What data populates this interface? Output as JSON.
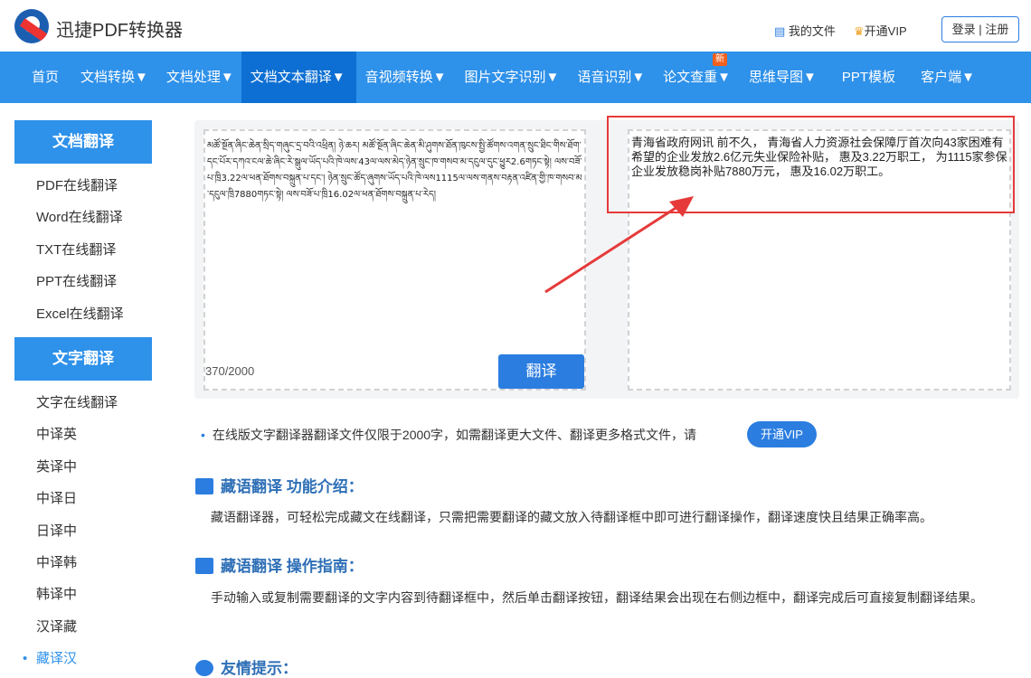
{
  "header": {
    "brand": "迅捷PDF转换器",
    "my_files": "我的文件",
    "open_vip": "开通VIP",
    "login": "登录",
    "sep": "|",
    "register": "注册"
  },
  "nav": [
    {
      "label": "首页"
    },
    {
      "label": "文档转换▼"
    },
    {
      "label": "文档处理▼"
    },
    {
      "label": "文档文本翻译▼"
    },
    {
      "label": "音视频转换▼"
    },
    {
      "label": "图片文字识别▼"
    },
    {
      "label": "语音识别▼"
    },
    {
      "label": "论文查重▼",
      "badge": "新"
    },
    {
      "label": "思维导图▼"
    },
    {
      "label": "PPT模板"
    },
    {
      "label": "客户端▼"
    }
  ],
  "sidebar": {
    "doc_title": "文档翻译",
    "doc_items": [
      "PDF在线翻译",
      "Word在线翻译",
      "TXT在线翻译",
      "PPT在线翻译",
      "Excel在线翻译"
    ],
    "text_title": "文字翻译",
    "text_items": [
      "文字在线翻译",
      "中译英",
      "英译中",
      "中译日",
      "日译中",
      "中译韩",
      "韩译中",
      "汉译藏",
      "藏译汉"
    ]
  },
  "translator": {
    "source_text": "མཚོ་སྔོན་ཞིང་ཆེན་སྲིད་གཞུང་དྲ་བའི་འཕྲིན། ཉེ་ཆར། མཚོ་སྔོན་ཞིང་ཆེན་མི་ཤུགས་ཐོན་ཁུངས་སྤྱི་ཚོགས་འགན་སྲུང་ཐིང་གིས་ཐོག་དང་པོར་དཀའ་ངལ་ཆེ་ཞིང་རེ་སྒུལ་ཡོད་པའི་ཁེ་ལས་43ལ་ལས་མེད་ཉེན་སྲུང་ཁ་གསབ་མ་དངུལ་དུང་ཕྱུར2.6གཏང་སྟེ། ལས་བཟོ་པ་ཁྲི3.22ལ་ཕན་ཐོགས་བསྐྲུན་པ་དང་། ཉེན་སྲུང་ཚོད་ཞུགས་ཡོད་པའི་ཁེ་ལས1115ལ་ལས་གནས་བརྟན་འཛིན་གྱི་ཁ་གསབ་མ་དངུལ་ཁྲི7880གཏང་སྟེ། ལས་བཟོ་པ་ཁྲི16.02ལ་ཕན་ཐོགས་བསྐྲུན་པ་རེད།",
    "char_count": "370/2000",
    "translate_button": "翻译",
    "result_text": "青海省政府网讯 前不久， 青海省人力资源社会保障厅首次向43家困难有希望的企业发放2.6亿元失业保险补贴， 惠及3.22万职工， 为1115家参保企业发放稳岗补贴7880万元， 惠及16.02万职工。"
  },
  "notice": {
    "text": "在线版文字翻译器翻译文件仅限于2000字，如需翻译更大文件、翻译更多格式文件，请",
    "button": "开通VIP"
  },
  "sections": [
    {
      "title": "藏语翻译 功能介绍：",
      "body": "藏语翻译器，可轻松完成藏文在线翻译，只需把需要翻译的藏文放入待翻译框中即可进行翻译操作，翻译速度快且结果正确率高。"
    },
    {
      "title": "藏语翻译 操作指南：",
      "body": "手动输入或复制需要翻译的文字内容到待翻译框中，然后单击翻译按钮，翻译结果会出现在右侧边框中，翻译完成后可直接复制翻译结果。"
    },
    {
      "title": "友情提示：",
      "body": ""
    }
  ]
}
